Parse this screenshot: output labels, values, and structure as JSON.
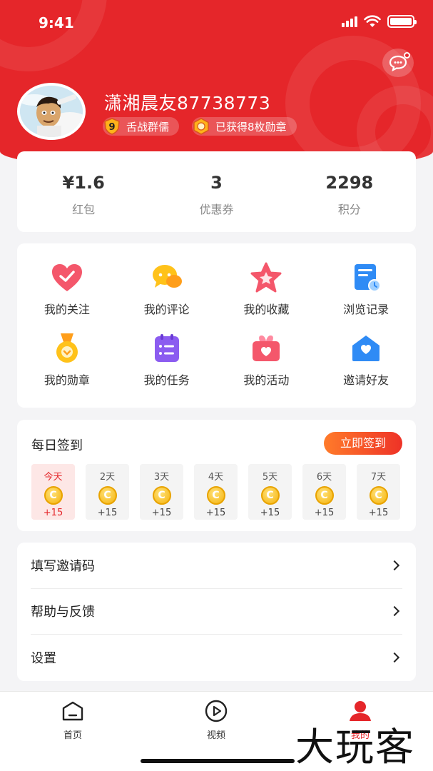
{
  "status": {
    "time": "9:41"
  },
  "profile": {
    "name": "潇湘晨友87738773",
    "badge_level": "舌战群儒",
    "badge_level_number": "9",
    "badge_medals": "已获得8枚勋章"
  },
  "stats": [
    {
      "value": "¥1.6",
      "label": "红包"
    },
    {
      "value": "3",
      "label": "优惠券"
    },
    {
      "value": "2298",
      "label": "积分"
    }
  ],
  "menu": [
    {
      "label": "我的关注",
      "icon": "heart-icon"
    },
    {
      "label": "我的评论",
      "icon": "chat-bubble-icon"
    },
    {
      "label": "我的收藏",
      "icon": "star-icon"
    },
    {
      "label": "浏览记录",
      "icon": "history-doc-icon"
    },
    {
      "label": "我的勋章",
      "icon": "medal-icon"
    },
    {
      "label": "我的任务",
      "icon": "task-list-icon"
    },
    {
      "label": "我的活动",
      "icon": "gift-box-icon"
    },
    {
      "label": "邀请好友",
      "icon": "envelope-icon"
    }
  ],
  "checkin": {
    "title": "每日签到",
    "button": "立即签到",
    "days": [
      {
        "label": "今天",
        "points": "+15"
      },
      {
        "label": "2天",
        "points": "+15"
      },
      {
        "label": "3天",
        "points": "+15"
      },
      {
        "label": "4天",
        "points": "+15"
      },
      {
        "label": "5天",
        "points": "+15"
      },
      {
        "label": "6天",
        "points": "+15"
      },
      {
        "label": "7天",
        "points": "+15"
      }
    ]
  },
  "settings": [
    {
      "label": "填写邀请码"
    },
    {
      "label": "帮助与反馈"
    },
    {
      "label": "设置"
    }
  ],
  "tabs": [
    {
      "label": "首页",
      "icon": "home-icon"
    },
    {
      "label": "视频",
      "icon": "play-icon"
    },
    {
      "label": "我的",
      "icon": "user-icon"
    }
  ],
  "watermark": "大玩客",
  "colors": {
    "brand_red": "#e5262a",
    "button_orange": "#ff7b2a"
  }
}
